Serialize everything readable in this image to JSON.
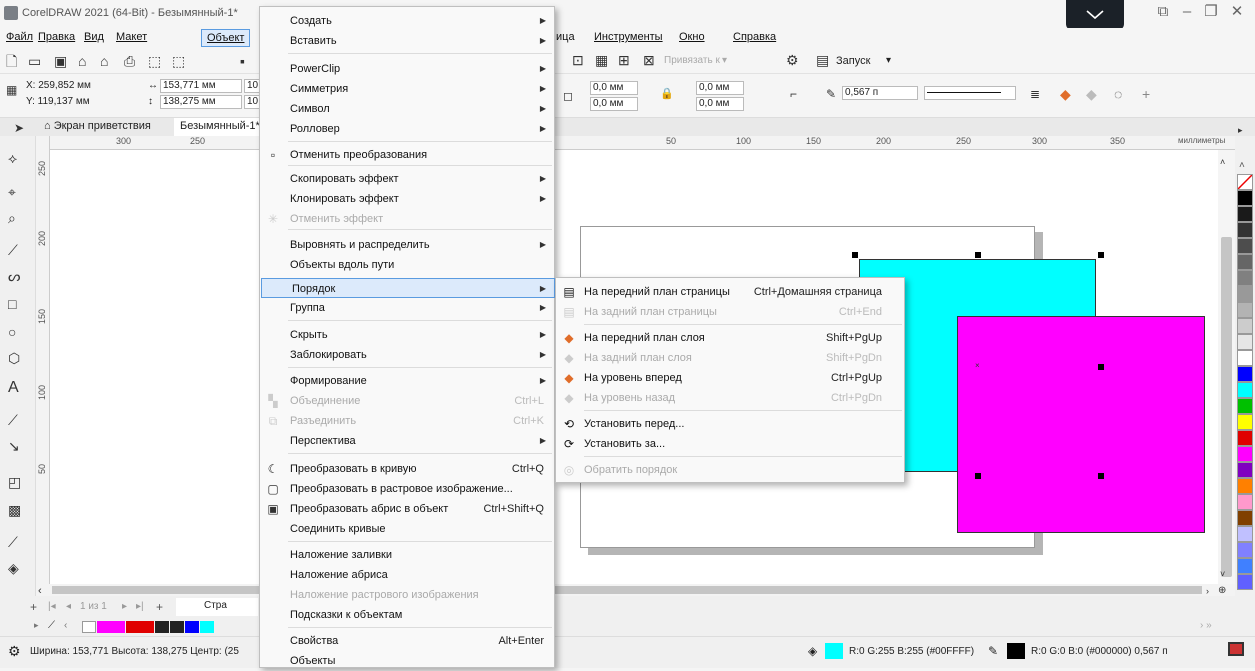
{
  "title": "CorelDRAW 2021 (64-Bit) - Безымянный-1*",
  "menubar": [
    "Файл",
    "Правка",
    "Вид",
    "Макет",
    "Объект",
    "ица",
    "Инструменты",
    "Окно",
    "Справка"
  ],
  "toolbar1": {
    "snap": "Привязать к",
    "launch": "Запуск"
  },
  "toolbar2": {
    "x": "X: 259,852 мм",
    "y": "Y: 119,137 мм",
    "w": "153,771 мм",
    "h": "138,275 мм",
    "w_pct": "10",
    "h_pct": "10",
    "corner1": "0,0 мм",
    "corner2": "0,0 мм",
    "corner3": "0,0 мм",
    "corner4": "0,0 мм",
    "outline": "0,567 п"
  },
  "tabs": {
    "welcome": "Экран приветствия",
    "doc": "Безымянный-1*"
  },
  "ruler": {
    "h_ticks": [
      "300",
      "250",
      "50",
      "100",
      "150",
      "200",
      "250",
      "300",
      "350"
    ],
    "unit": "миллиметры",
    "v_ticks": [
      "250",
      "200",
      "150",
      "100",
      "50"
    ]
  },
  "object_menu": [
    {
      "label": "Создать",
      "arrow": true
    },
    {
      "label": "Вставить",
      "arrow": true
    },
    {
      "sep": true
    },
    {
      "label": "PowerClip",
      "arrow": true
    },
    {
      "label": "Симметрия",
      "arrow": true
    },
    {
      "label": "Символ",
      "arrow": true
    },
    {
      "label": "Ролловер",
      "arrow": true
    },
    {
      "sep": true
    },
    {
      "label": "Отменить преобразования",
      "icon": "reset-transform-icon"
    },
    {
      "sep": true
    },
    {
      "label": "Скопировать эффект",
      "arrow": true
    },
    {
      "label": "Клонировать эффект",
      "arrow": true
    },
    {
      "label": "Отменить эффект",
      "disabled": true,
      "icon": "clear-effect-icon"
    },
    {
      "sep": true
    },
    {
      "label": "Выровнять и распределить",
      "arrow": true
    },
    {
      "label": "Объекты вдоль пути"
    },
    {
      "label": "Порядок",
      "arrow": true,
      "highlight": true
    },
    {
      "label": "Группа",
      "arrow": true
    },
    {
      "sep": true
    },
    {
      "label": "Скрыть",
      "arrow": true
    },
    {
      "label": "Заблокировать",
      "arrow": true
    },
    {
      "sep": true
    },
    {
      "label": "Формирование",
      "arrow": true
    },
    {
      "label": "Объединение",
      "shortcut": "Ctrl+L",
      "disabled": true,
      "icon": "combine-icon"
    },
    {
      "label": "Разъединить",
      "shortcut": "Ctrl+K",
      "disabled": true,
      "icon": "break-apart-icon"
    },
    {
      "label": "Перспектива",
      "arrow": true
    },
    {
      "sep": true
    },
    {
      "label": "Преобразовать в кривую",
      "shortcut": "Ctrl+Q",
      "icon": "convert-curve-icon"
    },
    {
      "label": "Преобразовать в растровое изображение...",
      "icon": "convert-bitmap-icon"
    },
    {
      "label": "Преобразовать абрис в объект",
      "shortcut": "Ctrl+Shift+Q",
      "icon": "outline-object-icon"
    },
    {
      "label": "Соединить кривые"
    },
    {
      "sep": true
    },
    {
      "label": "Наложение заливки"
    },
    {
      "label": "Наложение абриса"
    },
    {
      "label": "Наложение растрового изображения",
      "disabled": true
    },
    {
      "label": "Подсказки к объектам"
    },
    {
      "sep": true
    },
    {
      "label": "Свойства",
      "shortcut": "Alt+Enter"
    },
    {
      "label": "Объекты"
    }
  ],
  "order_submenu": [
    {
      "label": "На передний план страницы",
      "shortcut": "Ctrl+Домашняя страница",
      "icon": "page-front-icon"
    },
    {
      "label": "На задний план страницы",
      "shortcut": "Ctrl+End",
      "disabled": true,
      "icon": "page-back-icon"
    },
    {
      "sep": true
    },
    {
      "label": "На передний план слоя",
      "shortcut": "Shift+PgUp",
      "icon": "layer-front-icon"
    },
    {
      "label": "На задний план слоя",
      "shortcut": "Shift+PgDn",
      "disabled": true,
      "icon": "layer-back-icon"
    },
    {
      "label": "На уровень вперед",
      "shortcut": "Ctrl+PgUp",
      "icon": "forward-one-icon"
    },
    {
      "label": "На уровень назад",
      "shortcut": "Ctrl+PgDn",
      "disabled": true,
      "icon": "back-one-icon"
    },
    {
      "sep": true
    },
    {
      "label": "Установить перед...",
      "icon": "in-front-of-icon"
    },
    {
      "label": "Установить за...",
      "icon": "behind-icon"
    },
    {
      "sep": true
    },
    {
      "label": "Обратить порядок",
      "disabled": true,
      "icon": "reverse-order-icon"
    }
  ],
  "pager": {
    "count": "1 из 1",
    "page_tab": "Стра"
  },
  "status": {
    "info": "Ширина: 153,771 Высота: 138,275 Центр: (25",
    "fill": "R:0 G:255 B:255 (#00FFFF)",
    "outline": "R:0 G:0 B:0 (#000000)  0,567 п"
  },
  "colors": {
    "cyan": "#00ffff",
    "magenta": "#ff00ff",
    "accent": "#5a9be0"
  }
}
